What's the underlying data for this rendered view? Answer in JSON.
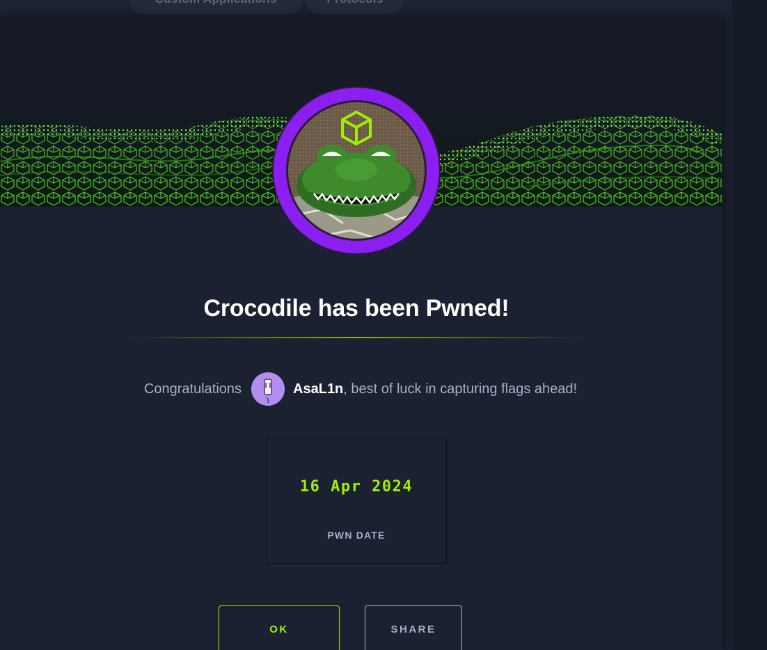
{
  "background_tabs": {
    "items": [
      "Custom Applications",
      "Protocols"
    ]
  },
  "modal": {
    "title": "Crocodile has been Pwned!",
    "congrats": {
      "prefix": "Congratulations",
      "username": "AsaL1n",
      "suffix": ", best of luck in capturing flags ahead!"
    },
    "pwn": {
      "date": "16 Apr 2024",
      "label": "PWN DATE"
    },
    "buttons": {
      "ok": "OK",
      "share": "SHARE"
    }
  },
  "colors": {
    "accent": "#9fef00",
    "ring": "#8a1ff0",
    "background": "#1b2130",
    "text_muted": "#a4b1cd"
  },
  "icons": {
    "machine_avatar": "crocodile-icon",
    "user_avatar": "user-avatar",
    "banner": "network-wave-banner"
  }
}
